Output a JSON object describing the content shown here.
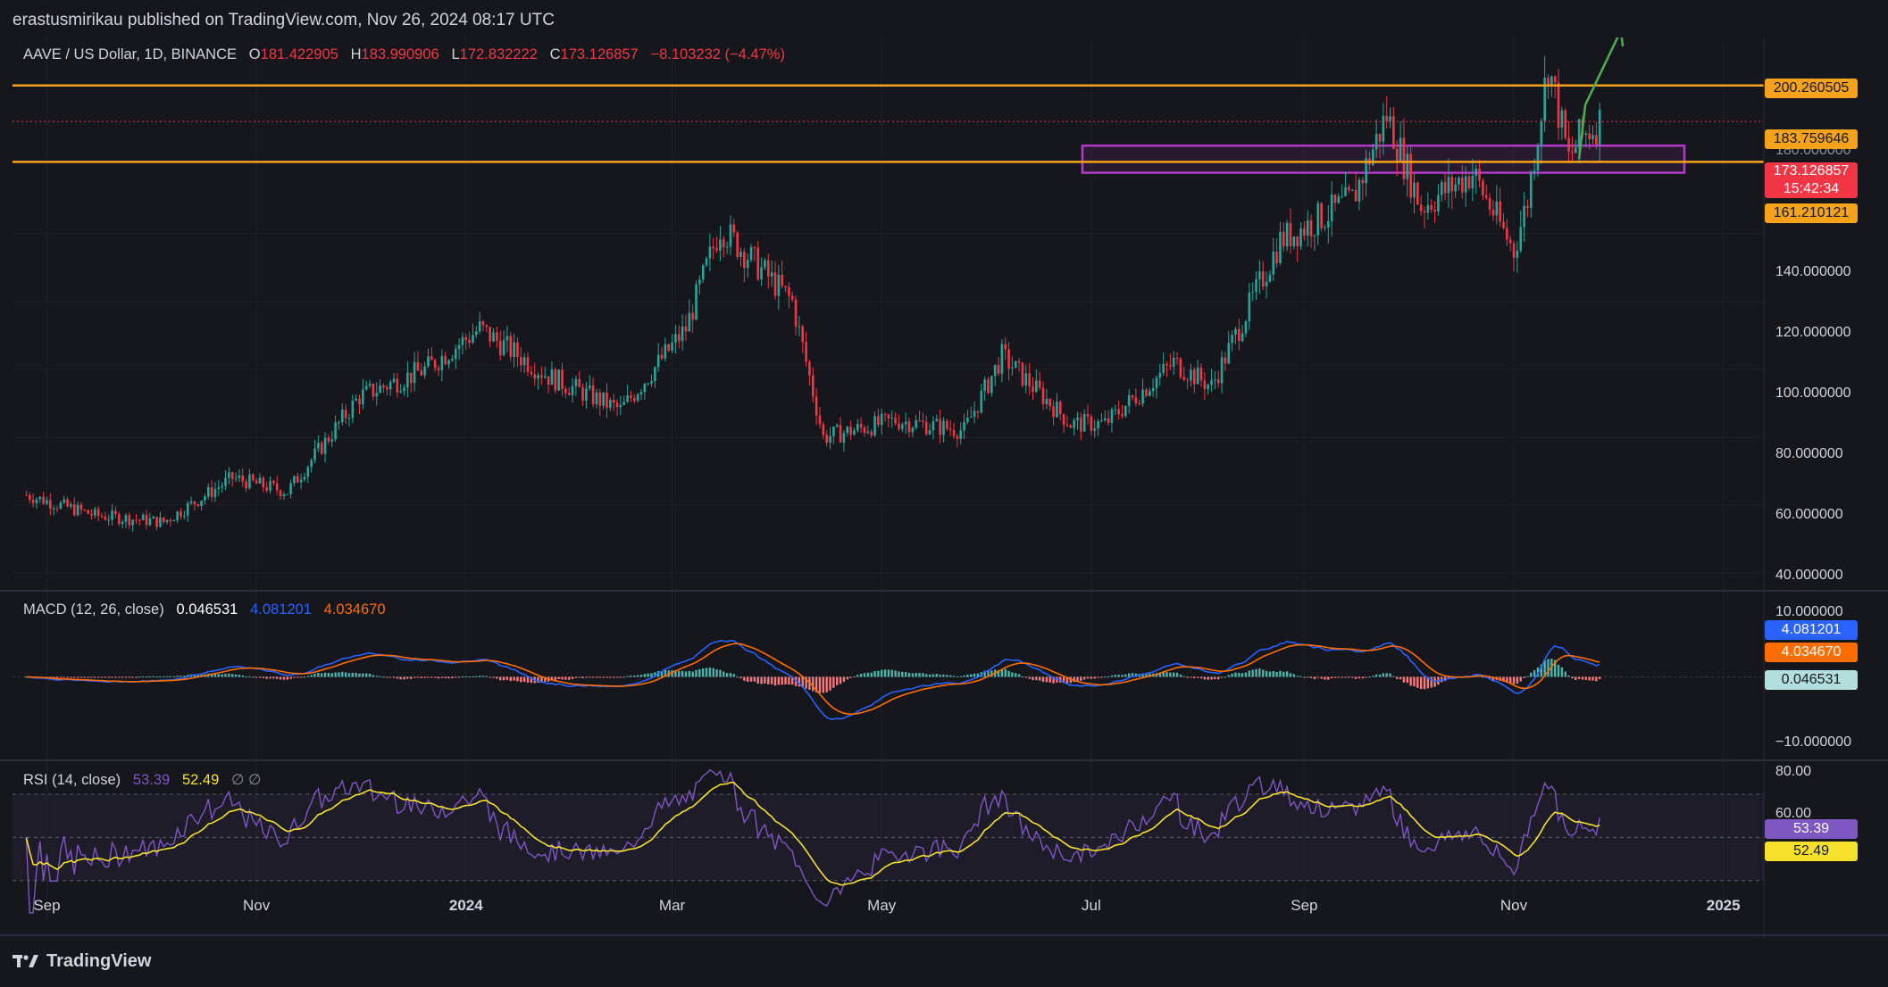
{
  "publisher": "erastusmirikau published on TradingView.com, Nov 26, 2024 08:17 UTC",
  "footer_logo": "TradingView",
  "colors": {
    "background": "#15171c",
    "up": "#26a69a",
    "down": "#f23645",
    "level_line": "#f7a21b",
    "zone": "#b23ac6",
    "arrow": "#4caf50",
    "macd": "#2962ff",
    "signal": "#ff6d00",
    "rsi": "#7e57c2",
    "rsi_ma": "#f5e12c"
  },
  "header": {
    "symbol": "AAVE / US Dollar, 1D, BINANCE",
    "o_label": "O",
    "o_value": "181.422905",
    "h_label": "H",
    "h_value": "183.990906",
    "l_label": "L",
    "l_value": "172.832222",
    "c_label": "C",
    "c_value": "173.126857",
    "change": "−8.103232 (−4.47%)"
  },
  "price_labels": {
    "r1": "200.260505",
    "r2": "183.759646",
    "last": "173.126857",
    "countdown": "15:42:34",
    "support": "161.210121"
  },
  "price_axis": [
    "140.000000",
    "120.000000",
    "100.000000",
    "80.000000",
    "60.000000",
    "40.000000"
  ],
  "macd": {
    "title": "MACD (12, 26, close)",
    "hist": "0.046531",
    "macd": "4.081201",
    "signal": "4.034670",
    "axis_top": "10.000000",
    "axis_bottom": "−10.000000"
  },
  "rsi": {
    "title": "RSI (14, close)",
    "rsi": "53.39",
    "ma": "52.49",
    "extra": "∅ ∅",
    "axis": [
      "80.00",
      "60.00"
    ]
  },
  "time_axis": [
    "Sep",
    "Nov",
    "2024",
    "Mar",
    "May",
    "Jul",
    "Sep",
    "Nov",
    "2025"
  ],
  "chart_data": {
    "type": "candlestick",
    "symbol": "AAVE / US Dollar",
    "interval": "1D",
    "ylim": [
      40,
      205
    ],
    "levels": [
      200.260505,
      183.759646,
      161.210121
    ],
    "zone": [
      158,
      166
    ],
    "close_path_x": [
      "2023-08-26",
      "2023-09-15",
      "2023-10-05",
      "2023-10-25",
      "2023-11-10",
      "2023-12-01",
      "2023-12-20",
      "2024-01-05",
      "2024-01-25",
      "2024-02-15",
      "2024-03-05",
      "2024-03-15",
      "2024-04-05",
      "2024-04-14",
      "2024-05-05",
      "2024-05-25",
      "2024-06-05",
      "2024-06-25",
      "2024-07-05",
      "2024-07-25",
      "2024-08-05",
      "2024-08-25",
      "2024-09-15",
      "2024-09-25",
      "2024-10-05",
      "2024-10-20",
      "2024-11-01",
      "2024-11-05",
      "2024-11-11",
      "2024-11-17",
      "2024-11-20",
      "2024-11-26"
    ],
    "close_path_y": [
      63,
      57,
      55,
      68,
      64,
      92,
      100,
      112,
      98,
      88,
      112,
      142,
      120,
      80,
      85,
      82,
      104,
      84,
      84,
      102,
      95,
      138,
      150,
      175,
      148,
      158,
      135,
      150,
      190,
      162,
      168,
      173.13
    ],
    "macd_hist_last": 0.046531,
    "macd_last": 4.081201,
    "signal_last": 4.03467,
    "rsi_last": 53.39,
    "rsi_ma_last": 52.49
  }
}
